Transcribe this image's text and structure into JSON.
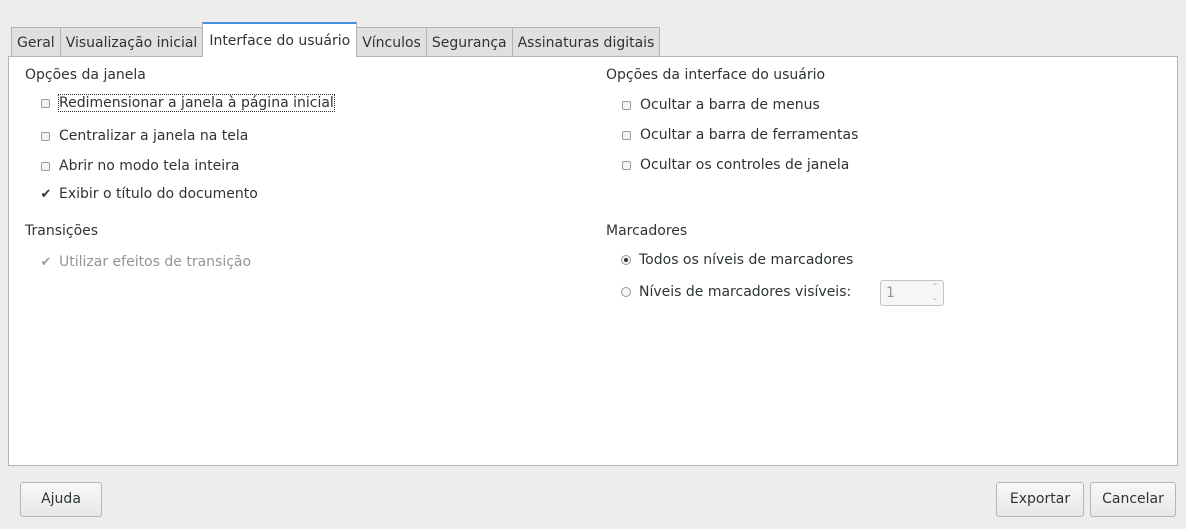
{
  "tabs": [
    {
      "label": "Geral",
      "active": false
    },
    {
      "label": "Visualização inicial",
      "active": false
    },
    {
      "label": "Interface do usuário",
      "active": true
    },
    {
      "label": "Vínculos",
      "active": false
    },
    {
      "label": "Segurança",
      "active": false
    },
    {
      "label": "Assinaturas digitais",
      "active": false
    }
  ],
  "window_options": {
    "title": "Opções da janela",
    "resize": {
      "label": "Redimensionar a janela à página inicial",
      "checked": false
    },
    "center": {
      "label": "Centralizar a janela na tela",
      "checked": false
    },
    "fullscreen": {
      "label": "Abrir no modo tela inteira",
      "checked": false
    },
    "show_title": {
      "label": "Exibir o título do documento",
      "checked": true
    }
  },
  "transitions": {
    "title": "Transições",
    "use_effects": {
      "label": "Utilizar efeitos de transição",
      "checked": true,
      "disabled": true
    }
  },
  "ui_options": {
    "title": "Opções da interface do usuário",
    "hide_menubar": {
      "label": "Ocultar a barra de menus",
      "checked": false
    },
    "hide_toolbar": {
      "label": "Ocultar a barra de ferramentas",
      "checked": false
    },
    "hide_controls": {
      "label": "Ocultar os controles de janela",
      "checked": false
    }
  },
  "bookmarks": {
    "title": "Marcadores",
    "all_levels": {
      "label": "Todos os níveis de marcadores",
      "selected": true
    },
    "visible_levels": {
      "label": "Níveis de marcadores visíveis:",
      "selected": false
    },
    "levels_value": "1"
  },
  "buttons": {
    "help": "Ajuda",
    "export": "Exportar",
    "cancel": "Cancelar"
  }
}
